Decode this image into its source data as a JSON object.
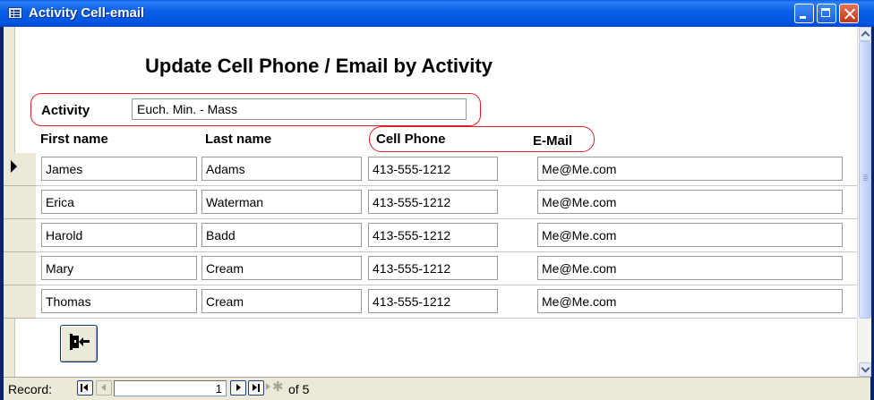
{
  "window": {
    "title": "Activity Cell-email"
  },
  "form": {
    "title": "Update Cell Phone / Email by Activity",
    "activity_label": "Activity",
    "activity_value": "Euch. Min. - Mass",
    "columns": {
      "first_name": "First name",
      "last_name": "Last name",
      "cell_phone": "Cell Phone",
      "email": "E-Mail"
    },
    "rows": [
      {
        "first": "James",
        "last": "Adams",
        "cell": "413-555-1212",
        "email": "Me@Me.com"
      },
      {
        "first": "Erica",
        "last": "Waterman",
        "cell": "413-555-1212",
        "email": "Me@Me.com"
      },
      {
        "first": "Harold",
        "last": "Badd",
        "cell": "413-555-1212",
        "email": "Me@Me.com"
      },
      {
        "first": "Mary",
        "last": "Cream",
        "cell": "413-555-1212",
        "email": "Me@Me.com"
      },
      {
        "first": "Thomas",
        "last": "Cream",
        "cell": "413-555-1212",
        "email": "Me@Me.com"
      }
    ],
    "current_row_index": 0,
    "exit_icon": "exit-door-icon",
    "highlight_color": "#e32020"
  },
  "navigation": {
    "record_label": "Record:",
    "current_record": "1",
    "of_text": "of 5"
  },
  "colors": {
    "titlebar": "#0054e3",
    "window_face": "#ece9d8"
  }
}
